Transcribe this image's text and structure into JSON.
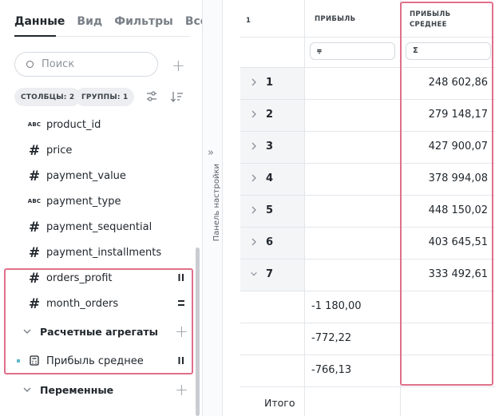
{
  "tabs": [
    "Данные",
    "Вид",
    "Фильтры",
    "Все"
  ],
  "search": {
    "placeholder": "Поиск"
  },
  "chips": {
    "columns": "СТОЛБЦЫ: 2",
    "groups": "ГРУППЫ: 1"
  },
  "fields": [
    {
      "type": "ABC",
      "name": "product_id"
    },
    {
      "type": "#",
      "name": "price"
    },
    {
      "type": "#",
      "name": "payment_value"
    },
    {
      "type": "ABC",
      "name": "payment_type"
    },
    {
      "type": "#",
      "name": "payment_sequential"
    },
    {
      "type": "#",
      "name": "payment_installments"
    },
    {
      "type": "#",
      "name": "orders_profit"
    },
    {
      "type": "#",
      "name": "month_orders"
    }
  ],
  "groups": {
    "aggregates": "Расчетные агрегаты",
    "aggregate_item": "Прибыль среднее",
    "variables": "Переменные"
  },
  "settings_panel": {
    "label": "Панель настройки"
  },
  "table": {
    "corner": "1",
    "headers": [
      "ПРИБЫЛЬ",
      "ПРИБЫЛЬ СРЕДНЕЕ"
    ],
    "header_b_lines": [
      "ПРИБЫЛЬ",
      "СРЕДНЕЕ"
    ],
    "rows": [
      {
        "label": "1",
        "avg": "248 602,86"
      },
      {
        "label": "2",
        "avg": "279 148,17"
      },
      {
        "label": "3",
        "avg": "427 900,07"
      },
      {
        "label": "4",
        "avg": "378 994,08"
      },
      {
        "label": "5",
        "avg": "448 150,02"
      },
      {
        "label": "6",
        "avg": "403 645,51"
      },
      {
        "label": "7",
        "avg": "333 492,61"
      }
    ],
    "subrows": [
      "-1 180,00",
      "-772,22",
      "-766,13"
    ],
    "total_label": "Итого"
  },
  "colors": {
    "highlight": "#e0708a",
    "accent_marker": "#5fb8c8"
  }
}
